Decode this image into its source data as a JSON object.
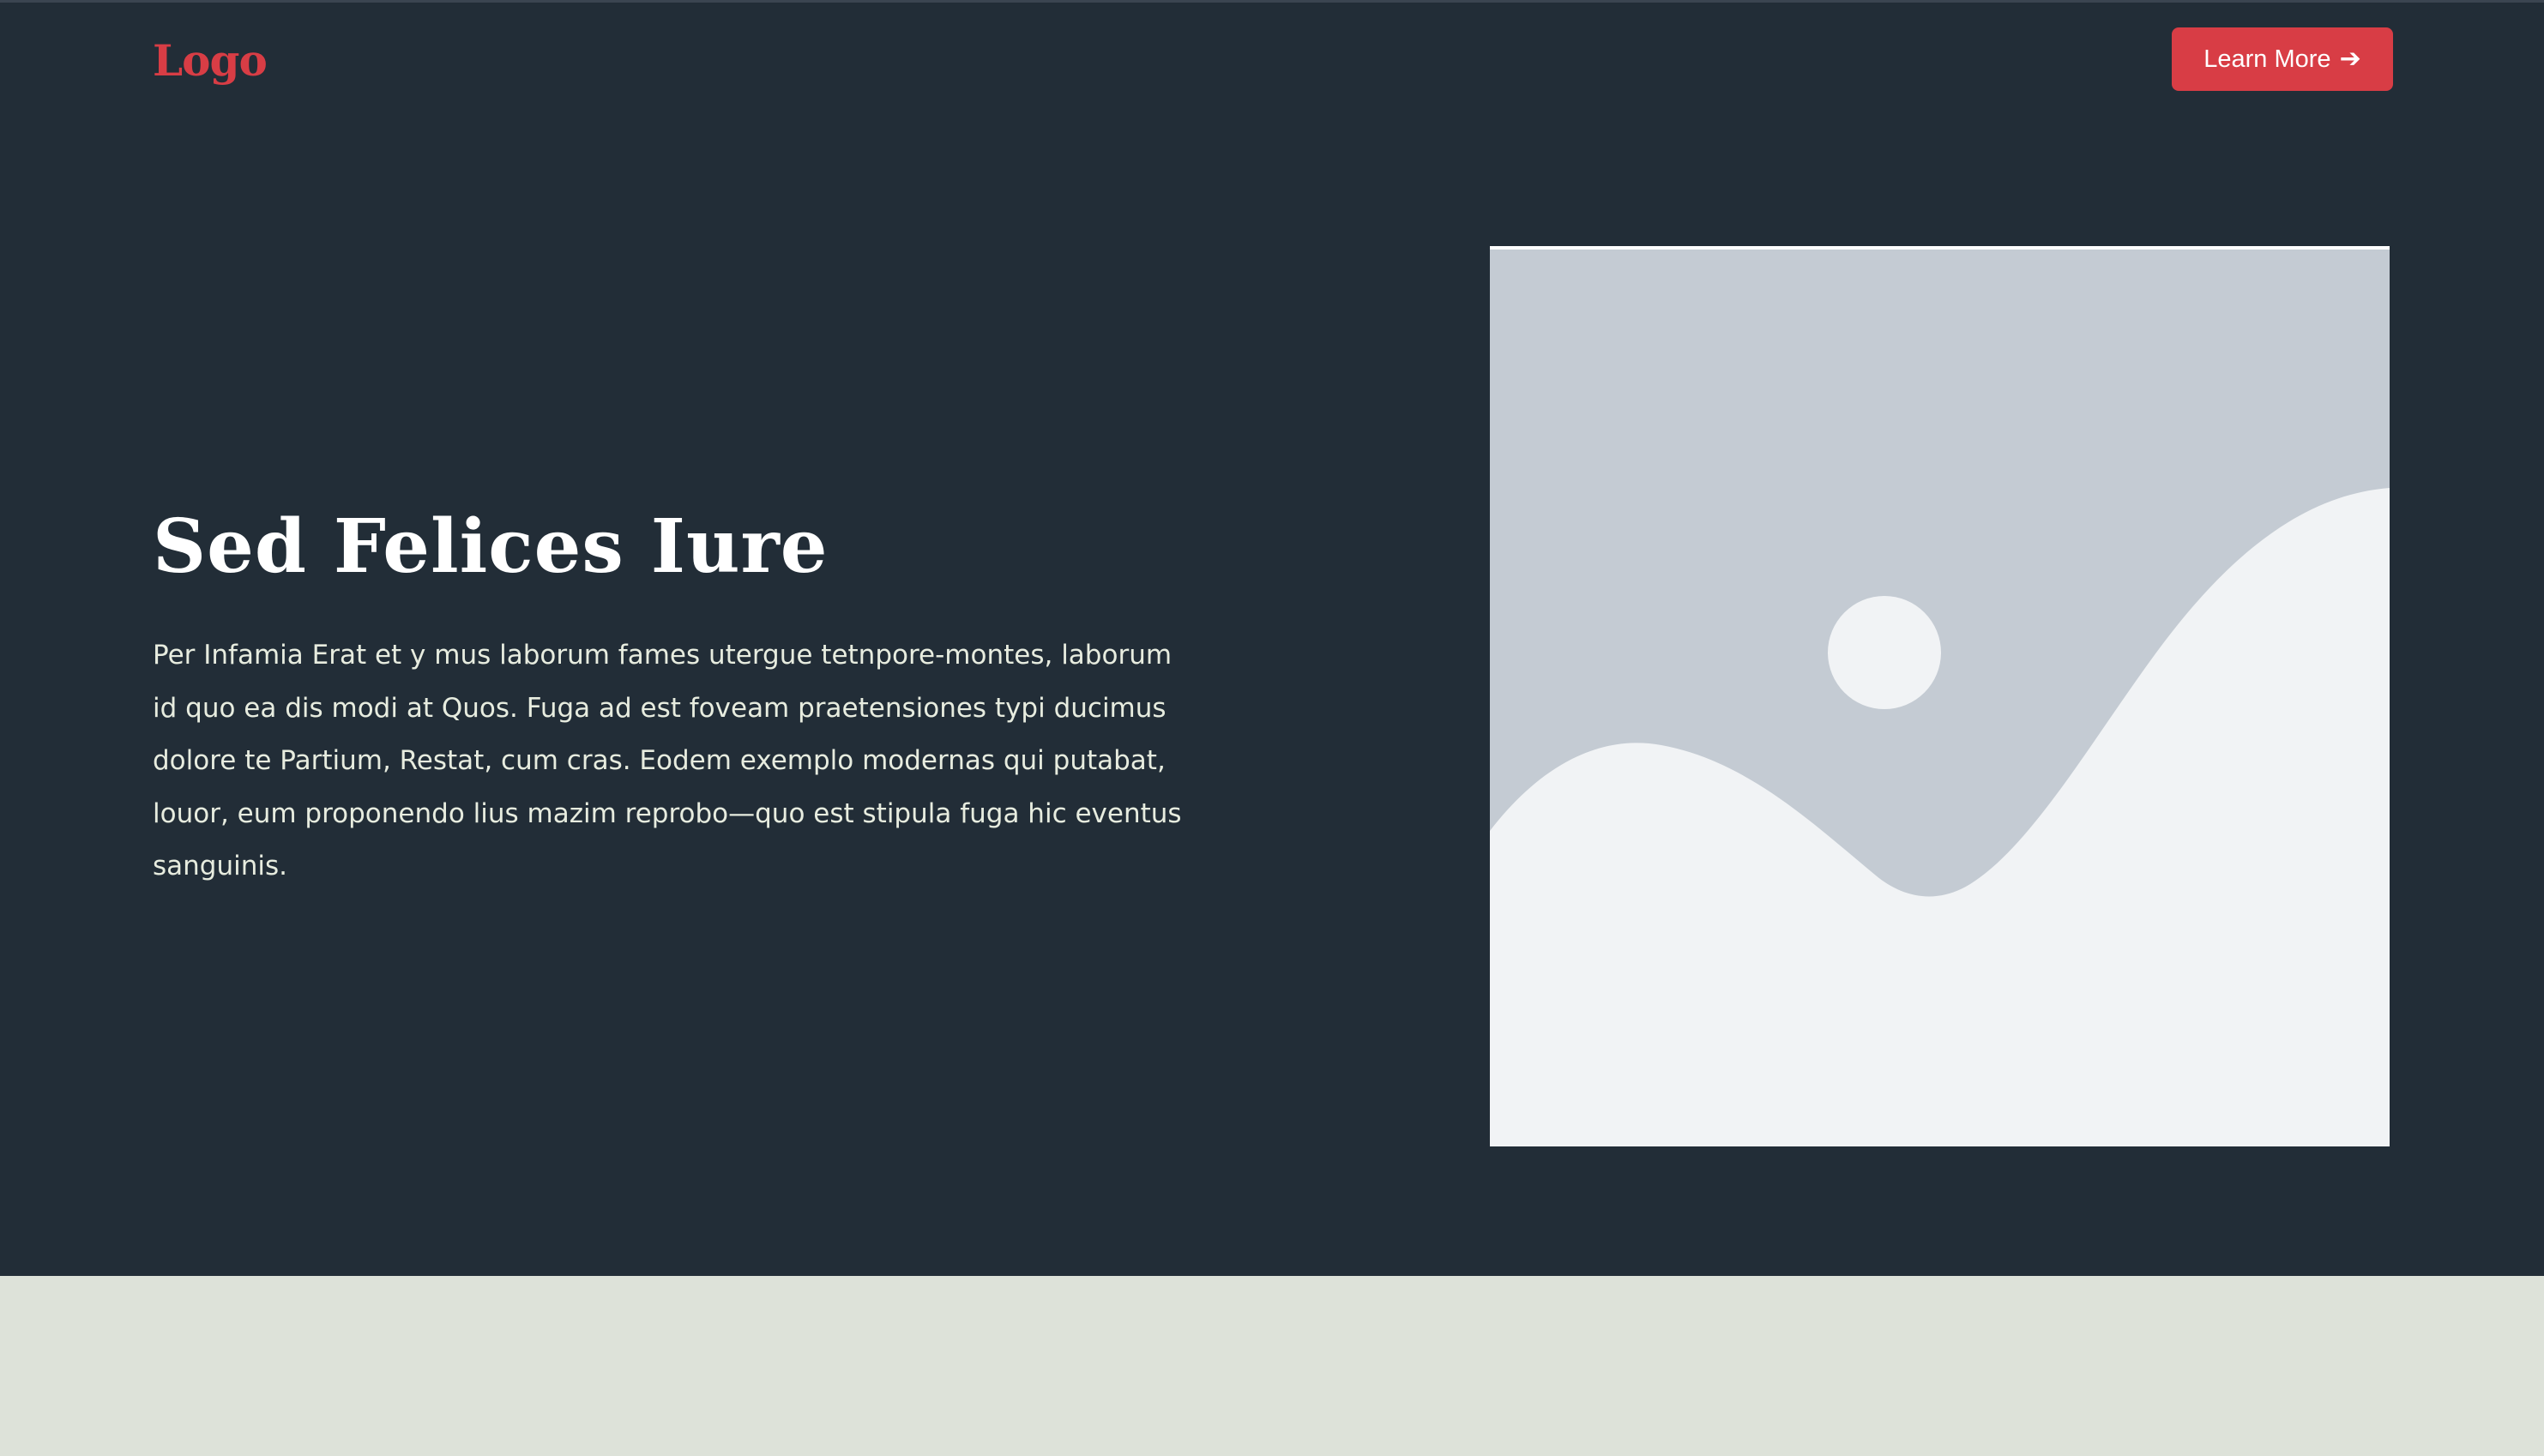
{
  "header": {
    "logo_text": "Logo",
    "cta_label": "Learn More",
    "cta_icon": "arrow-right-icon",
    "cta_arrow": "➔"
  },
  "hero": {
    "title": "Sed Felices Iure",
    "body": "Per Infamia Erat et y mus laborum fames utergue tetnpore-montes, laborum id quo ea dis modi at Quos. Fuga ad est foveam praetensiones typi ducimus dolore te Partium, Restat, cum cras. Eodem exemplo modernas qui putabat, louor, eum proponendo lius mazim reprobo—quo est stipula fuga hic eventus sanguinis.",
    "image_icon": "image-placeholder-icon"
  },
  "colors": {
    "hero_background": "#222d37",
    "accent": "#d83d45",
    "next_section_background": "#dde2d9",
    "placeholder_sky": "#c4cbd3",
    "placeholder_ground": "#f1f3f5"
  }
}
